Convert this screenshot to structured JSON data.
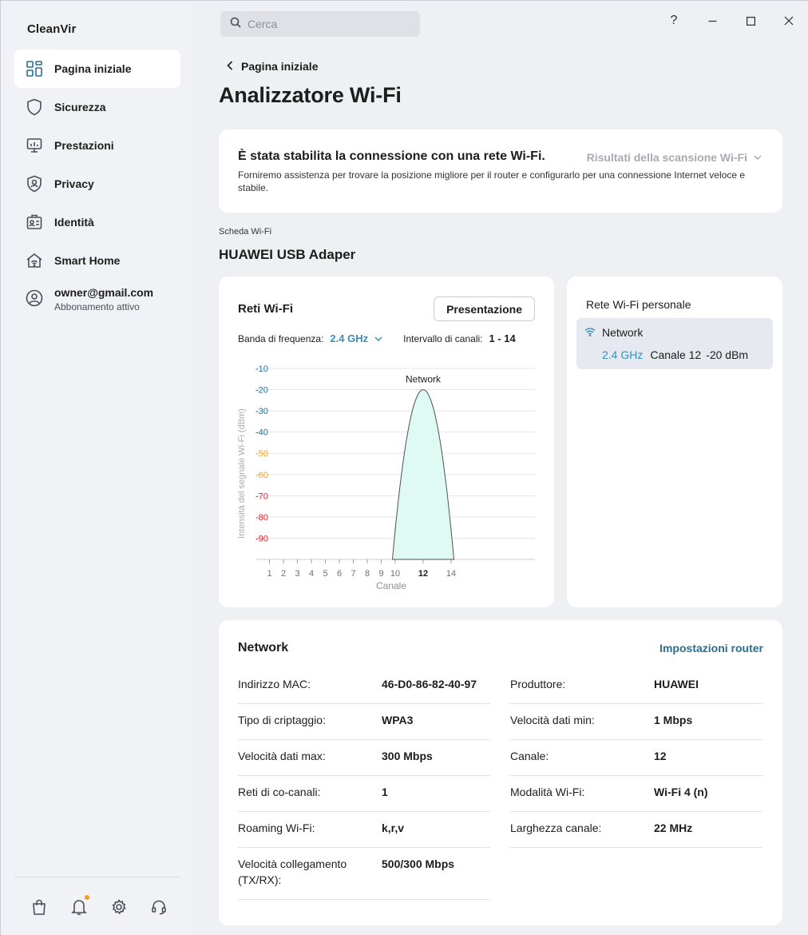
{
  "app": {
    "name": "CleanVir"
  },
  "sidebar": {
    "items": [
      {
        "label": "Pagina iniziale",
        "icon": "dashboard-icon",
        "active": true
      },
      {
        "label": "Sicurezza",
        "icon": "shield-icon"
      },
      {
        "label": "Prestazioni",
        "icon": "monitor-icon"
      },
      {
        "label": "Privacy",
        "icon": "privacy-shield-icon"
      },
      {
        "label": "Identità",
        "icon": "id-card-icon"
      },
      {
        "label": "Smart Home",
        "icon": "smart-home-icon"
      }
    ],
    "account": {
      "email": "owner@gmail.com",
      "subscription": "Abbonamento attivo"
    },
    "bottom_icons": [
      "bag-icon",
      "bell-icon",
      "gear-icon",
      "headset-icon"
    ]
  },
  "search": {
    "placeholder": "Cerca"
  },
  "window_controls": {
    "help": "?"
  },
  "breadcrumb": {
    "back_label": "Pagina iniziale"
  },
  "page": {
    "title": "Analizzatore Wi-Fi"
  },
  "connection": {
    "title": "È stata stabilita la connessione con una rete Wi-Fi.",
    "description": "Forniremo assistenza per trovare la posizione migliore per il router e configurarlo per una connessione Internet veloce e stabile.",
    "scan_results_label": "Risultati della scansione Wi-Fi"
  },
  "adapter": {
    "label": "Scheda Wi-Fi",
    "name": "HUAWEI USB Adaper"
  },
  "networks_card": {
    "title": "Reti Wi-Fi",
    "presentation_button": "Presentazione",
    "band_label": "Banda di frequenza:",
    "band_value": "2.4 GHz",
    "channel_range_label": "Intervallo di canali:",
    "channel_range_value": "1 - 14"
  },
  "chart_data": {
    "type": "area",
    "ylabel": "Intensità del segnale Wi-Fi (dBm)",
    "xlabel": "Canale",
    "y_ticks": [
      -10,
      -20,
      -30,
      -40,
      -50,
      -60,
      -70,
      -80,
      -90
    ],
    "y_tick_colors": {
      "-10": "#2b6d90",
      "-20": "#2b6d90",
      "-30": "#2b6d90",
      "-40": "#2b6d90",
      "-50": "#f0a02a",
      "-60": "#f0a02a",
      "-70": "#d9262e",
      "-80": "#d9262e",
      "-90": "#d9262e"
    },
    "x_ticks": [
      1,
      2,
      3,
      4,
      5,
      6,
      7,
      8,
      9,
      10,
      12,
      14
    ],
    "highlight_tick": 12,
    "ylim": [
      -100,
      -10
    ],
    "grid": true,
    "series": [
      {
        "name": "Network",
        "center_channel": 12,
        "peak_dbm": -20,
        "width_channels": 4.4,
        "fill": "#dffaf3",
        "stroke": "#4e5157"
      }
    ]
  },
  "personal": {
    "title": "Rete Wi-Fi personale",
    "network": {
      "name": "Network",
      "band": "2.4 GHz",
      "channel": "Canale 12",
      "signal": "-20 dBm"
    }
  },
  "details": {
    "title": "Network",
    "router_settings_link": "Impostazioni router",
    "left": [
      {
        "key": "Indirizzo MAC:",
        "value": "46-D0-86-82-40-97"
      },
      {
        "key": "Tipo di criptaggio:",
        "value": "WPA3"
      },
      {
        "key": "Velocità dati max:",
        "value": "300 Mbps"
      },
      {
        "key": "Reti di co-canali:",
        "value": "1"
      },
      {
        "key": "Roaming Wi-Fi:",
        "value": "k,r,v"
      },
      {
        "key": "Velocità collegamento (TX/RX):",
        "value": "500/300 Mbps"
      }
    ],
    "right": [
      {
        "key": "Produttore:",
        "value": "HUAWEI"
      },
      {
        "key": "Velocità dati min:",
        "value": "1 Mbps"
      },
      {
        "key": "Canale:",
        "value": "12"
      },
      {
        "key": "Modalità Wi-Fi:",
        "value": "Wi-Fi 4 (n)"
      },
      {
        "key": "Larghezza canale:",
        "value": "22 MHz"
      }
    ]
  }
}
